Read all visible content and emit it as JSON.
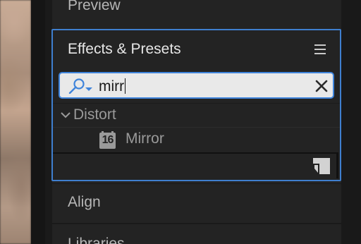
{
  "panels": {
    "preview": {
      "label": "Preview"
    },
    "effects_presets": {
      "title": "Effects & Presets",
      "search": {
        "value": "mirr"
      },
      "tree": {
        "category": {
          "label": "Distort",
          "expanded": true
        },
        "items": [
          {
            "label": "Mirror",
            "badge": "16"
          }
        ]
      }
    },
    "align": {
      "label": "Align"
    },
    "libraries": {
      "label": "Libraries"
    }
  },
  "colors": {
    "focus_border": "#3f7fcf",
    "search_accent": "#3f84db",
    "panel_bg": "#232323",
    "dim_text": "#9a9a9a"
  },
  "icons": {
    "panel_menu": "hamburger-icon",
    "search": "search-dropdown-icon",
    "clear": "close-icon",
    "expand": "chevron-down-icon",
    "effect": "bit-depth-16-icon",
    "new_folder": "new-item-icon"
  }
}
